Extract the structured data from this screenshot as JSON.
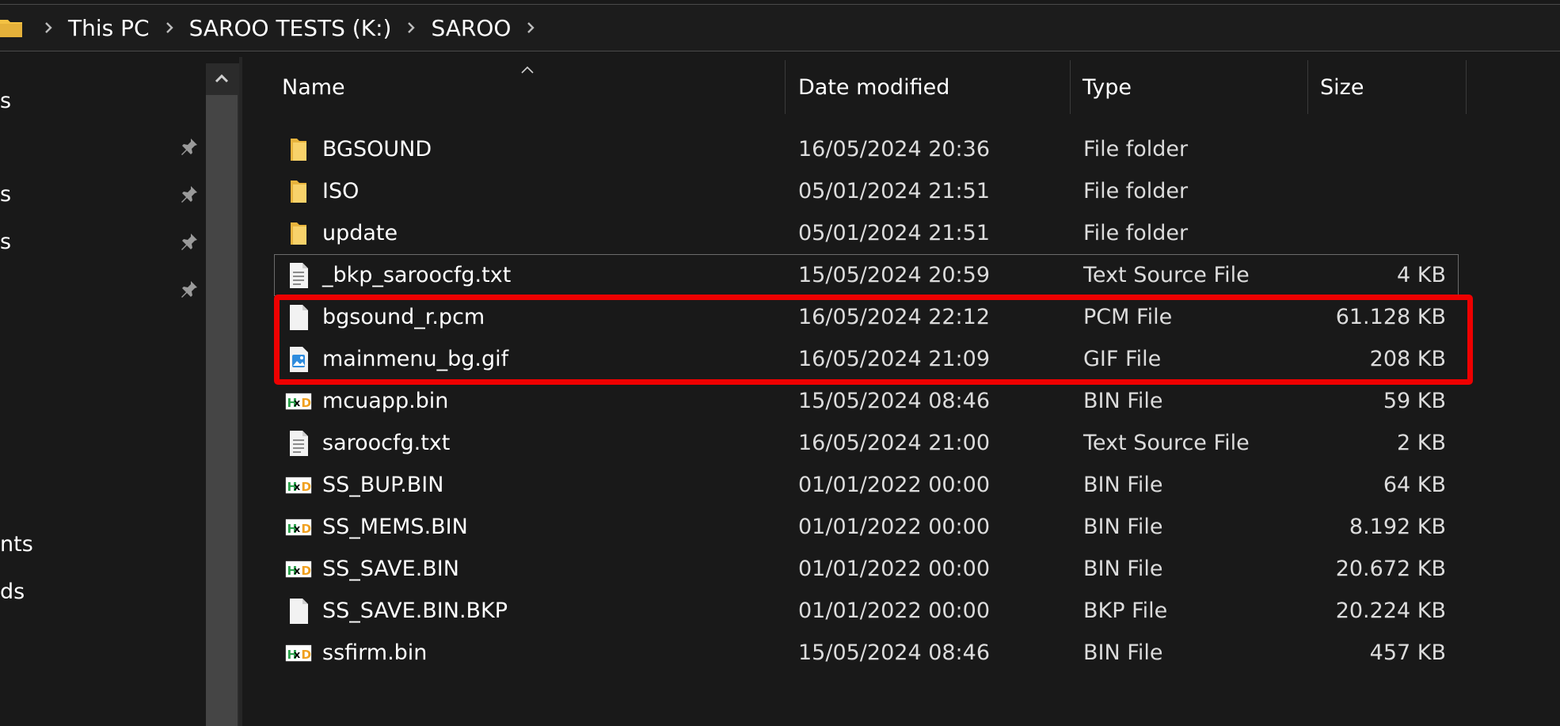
{
  "breadcrumb": {
    "items": [
      "This PC",
      "SAROO TESTS (K:)",
      "SAROO"
    ]
  },
  "nav": {
    "fragments": [
      "s",
      "s",
      "s",
      "nts",
      "ds"
    ]
  },
  "columns": {
    "name": "Name",
    "date": "Date modified",
    "type": "Type",
    "size": "Size"
  },
  "files": [
    {
      "name": "BGSOUND",
      "date": "16/05/2024 20:36",
      "type": "File folder",
      "size": "",
      "icon": "folder-icon"
    },
    {
      "name": "ISO",
      "date": "05/01/2024 21:51",
      "type": "File folder",
      "size": "",
      "icon": "folder-icon"
    },
    {
      "name": "update",
      "date": "05/01/2024 21:51",
      "type": "File folder",
      "size": "",
      "icon": "folder-icon"
    },
    {
      "name": "_bkp_saroocfg.txt",
      "date": "15/05/2024 20:59",
      "type": "Text Source File",
      "size": "4 KB",
      "icon": "text-file-icon"
    },
    {
      "name": "bgsound_r.pcm",
      "date": "16/05/2024 22:12",
      "type": "PCM File",
      "size": "61.128 KB",
      "icon": "blank-file-icon"
    },
    {
      "name": "mainmenu_bg.gif",
      "date": "16/05/2024 21:09",
      "type": "GIF File",
      "size": "208 KB",
      "icon": "image-file-icon"
    },
    {
      "name": "mcuapp.bin",
      "date": "15/05/2024 08:46",
      "type": "BIN File",
      "size": "59 KB",
      "icon": "hxd-bin-icon"
    },
    {
      "name": "saroocfg.txt",
      "date": "16/05/2024 21:00",
      "type": "Text Source File",
      "size": "2 KB",
      "icon": "text-file-icon"
    },
    {
      "name": "SS_BUP.BIN",
      "date": "01/01/2022 00:00",
      "type": "BIN File",
      "size": "64 KB",
      "icon": "hxd-bin-icon"
    },
    {
      "name": "SS_MEMS.BIN",
      "date": "01/01/2022 00:00",
      "type": "BIN File",
      "size": "8.192 KB",
      "icon": "hxd-bin-icon"
    },
    {
      "name": "SS_SAVE.BIN",
      "date": "01/01/2022 00:00",
      "type": "BIN File",
      "size": "20.672 KB",
      "icon": "hxd-bin-icon"
    },
    {
      "name": "SS_SAVE.BIN.BKP",
      "date": "01/01/2022 00:00",
      "type": "BKP File",
      "size": "20.224 KB",
      "icon": "blank-file-icon"
    },
    {
      "name": "ssfirm.bin",
      "date": "15/05/2024 08:46",
      "type": "BIN File",
      "size": "457 KB",
      "icon": "hxd-bin-icon"
    }
  ],
  "colors": {
    "background": "#191919",
    "highlight": "#ee0000",
    "folder": "#f3c243"
  }
}
